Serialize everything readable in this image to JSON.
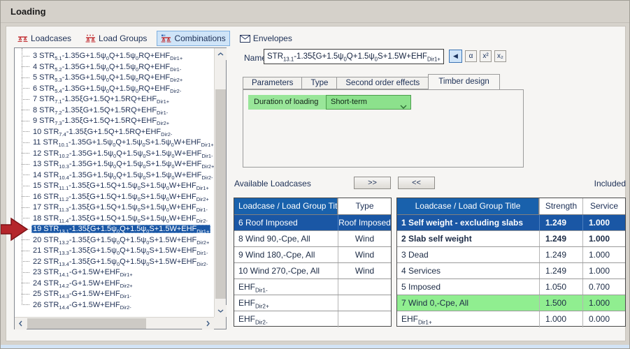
{
  "window": {
    "title": "Loading"
  },
  "toolbar": {
    "tabs": [
      {
        "label": "Loadcases",
        "selected": false
      },
      {
        "label": "Load Groups",
        "selected": false
      },
      {
        "label": "Combinations",
        "selected": true
      },
      {
        "label": "Envelopes",
        "selected": false
      }
    ]
  },
  "combinations": {
    "items": [
      {
        "id": 3,
        "text": "3 STR_{5.1}-1.35G+1.5ψ_{0}Q+1.5ψ_{0}RQ+EHF_{Dir1+}",
        "selected": false
      },
      {
        "id": 4,
        "text": "4 STR_{5.2}-1.35G+1.5ψ_{0}Q+1.5ψ_{0}RQ+EHF_{Dir1-}",
        "selected": false
      },
      {
        "id": 5,
        "text": "5 STR_{5.3}-1.35G+1.5ψ_{0}Q+1.5ψ_{0}RQ+EHF_{Dir2+}",
        "selected": false
      },
      {
        "id": 6,
        "text": "6 STR_{5.4}-1.35G+1.5ψ_{0}Q+1.5ψ_{0}RQ+EHF_{Dir2-}",
        "selected": false
      },
      {
        "id": 7,
        "text": "7 STR_{7.1}-1.35ξG+1.5Q+1.5RQ+EHF_{Dir1+}",
        "selected": false
      },
      {
        "id": 8,
        "text": "8 STR_{7.2}-1.35ξG+1.5Q+1.5RQ+EHF_{Dir1-}",
        "selected": false
      },
      {
        "id": 9,
        "text": "9 STR_{7.3}-1.35ξG+1.5Q+1.5RQ+EHF_{Dir2+}",
        "selected": false
      },
      {
        "id": 10,
        "text": "10 STR_{7.4}-1.35ξG+1.5Q+1.5RQ+EHF_{Dir2-}",
        "selected": false
      },
      {
        "id": 11,
        "text": "11 STR_{10.1}-1.35G+1.5ψ_{0}Q+1.5ψ_{0}S+1.5ψ_{0}W+EHF_{Dir1+}",
        "selected": false
      },
      {
        "id": 12,
        "text": "12 STR_{10.2}-1.35G+1.5ψ_{0}Q+1.5ψ_{0}S+1.5ψ_{0}W+EHF_{Dir1-}",
        "selected": false
      },
      {
        "id": 13,
        "text": "13 STR_{10.3}-1.35G+1.5ψ_{0}Q+1.5ψ_{0}S+1.5ψ_{0}W+EHF_{Dir2+}",
        "selected": false
      },
      {
        "id": 14,
        "text": "14 STR_{10.4}-1.35G+1.5ψ_{0}Q+1.5ψ_{0}S+1.5ψ_{0}W+EHF_{Dir2-}",
        "selected": false
      },
      {
        "id": 15,
        "text": "15 STR_{11.1}-1.35ξG+1.5Q+1.5ψ_{0}S+1.5ψ_{0}W+EHF_{Dir1+}",
        "selected": false
      },
      {
        "id": 16,
        "text": "16 STR_{11.2}-1.35ξG+1.5Q+1.5ψ_{0}S+1.5ψ_{0}W+EHF_{Dir2+}",
        "selected": false
      },
      {
        "id": 17,
        "text": "17 STR_{11.3}-1.35ξG+1.5Q+1.5ψ_{0}S+1.5ψ_{0}W+EHF_{Dir1-}",
        "selected": false
      },
      {
        "id": 18,
        "text": "18 STR_{11.4}-1.35ξG+1.5Q+1.5ψ_{0}S+1.5ψ_{0}W+EHF_{Dir2-}",
        "selected": false
      },
      {
        "id": 19,
        "text": "19 STR_{13.1}-1.35ξG+1.5ψ_{0}Q+1.5ψ_{0}S+1.5W+EHF_{Dir1+}",
        "selected": true
      },
      {
        "id": 20,
        "text": "20 STR_{13.2}-1.35ξG+1.5ψ_{0}Q+1.5ψ_{0}S+1.5W+EHF_{Dir2+}",
        "selected": false
      },
      {
        "id": 21,
        "text": "21 STR_{13.3}-1.35ξG+1.5ψ_{0}Q+1.5ψ_{0}S+1.5W+EHF_{Dir1-}",
        "selected": false
      },
      {
        "id": 22,
        "text": "22 STR_{13.4}-1.35ξG+1.5ψ_{0}Q+1.5ψ_{0}S+1.5W+EHF_{Dir2-}",
        "selected": false
      },
      {
        "id": 23,
        "text": "23 STR_{14.1}-G+1.5W+EHF_{Dir1+}",
        "selected": false
      },
      {
        "id": 24,
        "text": "24 STR_{14.2}-G+1.5W+EHF_{Dir2+}",
        "selected": false
      },
      {
        "id": 25,
        "text": "25 STR_{14.3}-G+1.5W+EHF_{Dir1-}",
        "selected": false
      },
      {
        "id": 26,
        "text": "26 STR_{14.4}-G+1.5W+EHF_{Dir2-}",
        "selected": false
      }
    ]
  },
  "name_field": {
    "label": "Name",
    "value": "STR_{13.1}-1.35ξG+1.5ψ_{0}Q+1.5ψ_{0}S+1.5W+EHF_{Dir1+}",
    "buttons": [
      {
        "glyph": "◀"
      },
      {
        "glyph": "α"
      },
      {
        "glyph": "x²"
      },
      {
        "glyph": "x₂"
      }
    ]
  },
  "design_tabs": {
    "tabs": [
      "Parameters",
      "Type",
      "Second order effects",
      "Timber design"
    ],
    "active": "Timber design"
  },
  "timber_design": {
    "duration_label": "Duration of loading",
    "duration_value": "Short-term"
  },
  "transfer": {
    "available_title": "Available Loadcases",
    "included_title": "Included",
    "add_button": ">>",
    "remove_button": "<<"
  },
  "available_table": {
    "columns": [
      "Loadcase / Load Group Title",
      "Type"
    ],
    "rows": [
      {
        "title": "6 Roof Imposed",
        "type": "Roof Imposed",
        "selected": true
      },
      {
        "title": "8 Wind 90,-Cpe, All",
        "type": "Wind",
        "selected": false
      },
      {
        "title": "9 Wind 180,-Cpe, All",
        "type": "Wind",
        "selected": false
      },
      {
        "title": "10 Wind 270,-Cpe, All",
        "type": "Wind",
        "selected": false
      },
      {
        "title": "EHF_{Dir1-}",
        "type": "",
        "selected": false
      },
      {
        "title": "EHF_{Dir2+}",
        "type": "",
        "selected": false
      },
      {
        "title": "EHF_{Dir2-}",
        "type": "",
        "selected": false
      }
    ]
  },
  "included_table": {
    "columns": [
      "Loadcase / Load Group Title",
      "Strength",
      "Service"
    ],
    "rows": [
      {
        "title": "1 Self weight - excluding slabs",
        "strength": "1.249",
        "service": "1.000",
        "selected": true,
        "bold": true,
        "green": false
      },
      {
        "title": "2 Slab self weight",
        "strength": "1.249",
        "service": "1.000",
        "selected": false,
        "bold": true,
        "green": false
      },
      {
        "title": "3 Dead",
        "strength": "1.249",
        "service": "1.000",
        "selected": false,
        "bold": false,
        "green": false
      },
      {
        "title": "4 Services",
        "strength": "1.249",
        "service": "1.000",
        "selected": false,
        "bold": false,
        "green": false
      },
      {
        "title": "5 Imposed",
        "strength": "1.050",
        "service": "0.700",
        "selected": false,
        "bold": false,
        "green": false
      },
      {
        "title": "7 Wind 0,-Cpe, All",
        "strength": "1.500",
        "service": "1.000",
        "selected": false,
        "bold": false,
        "green": true
      },
      {
        "title": "EHF_{Dir1+}",
        "strength": "1.000",
        "service": "0.000",
        "selected": false,
        "bold": false,
        "green": false
      }
    ]
  },
  "colors": {
    "header_blue": "#1961ac",
    "selection_blue": "#1a57a5",
    "row_green": "#90ee90",
    "tab_highlight": "#cfe4f8",
    "arrow_red": "#b5262b",
    "panel_bg": "#f6f5f3"
  }
}
